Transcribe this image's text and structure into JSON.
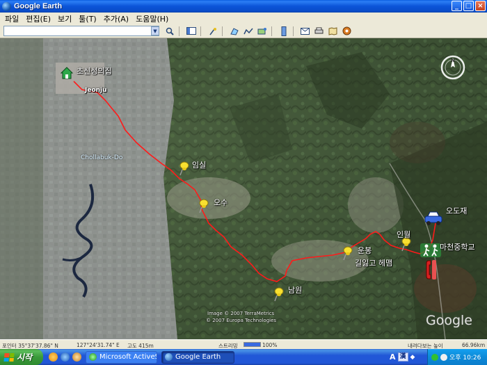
{
  "window": {
    "title": "Google Earth",
    "buttons": {
      "minimize": "_",
      "maximize": "□",
      "close": "×"
    }
  },
  "menu": [
    "파일",
    "편집(E)",
    "보기",
    "툴(T)",
    "추가(A)",
    "도움말(H)"
  ],
  "toolbar": {
    "search_value": "",
    "icons": [
      "magnifier-icon",
      "sidebar-icon",
      "placemark-icon",
      "polygon-icon",
      "path-icon",
      "image-overlay-icon",
      "ruler-icon",
      "email-icon",
      "print-icon",
      "maps-icon",
      "sky-icon"
    ]
  },
  "map": {
    "places": {
      "home": "초신성의집",
      "jeonju": "Jeonju",
      "imsil": "임실",
      "osu": "오수",
      "namwon": "남원",
      "unbong": "운봉",
      "inwol": "인월",
      "odojae": "오도재",
      "machon": "마천중학교",
      "lost": "길잃고 헤맴"
    },
    "region": "Chollabuk-Do",
    "credits": [
      "Image © 2007 TerraMetrics",
      "© 2007 Europa Technologies"
    ],
    "logo": "Google",
    "route_color": "#ff1a1a"
  },
  "status": {
    "pointer": "포인터 35°37'37.86\" N",
    "lon": "127°24'31.74\" E",
    "elev": "고도 415m",
    "streaming_label": "스트리밍",
    "streaming_value": "100%",
    "view_label": "내려다보는 높이",
    "eye_alt": "66.96km"
  },
  "taskbar": {
    "start": "시작",
    "tasks": [
      "Microsoft ActiveS...",
      "Google Earth"
    ],
    "ime": [
      "A",
      "漢"
    ],
    "clock": "오후 10:26"
  }
}
